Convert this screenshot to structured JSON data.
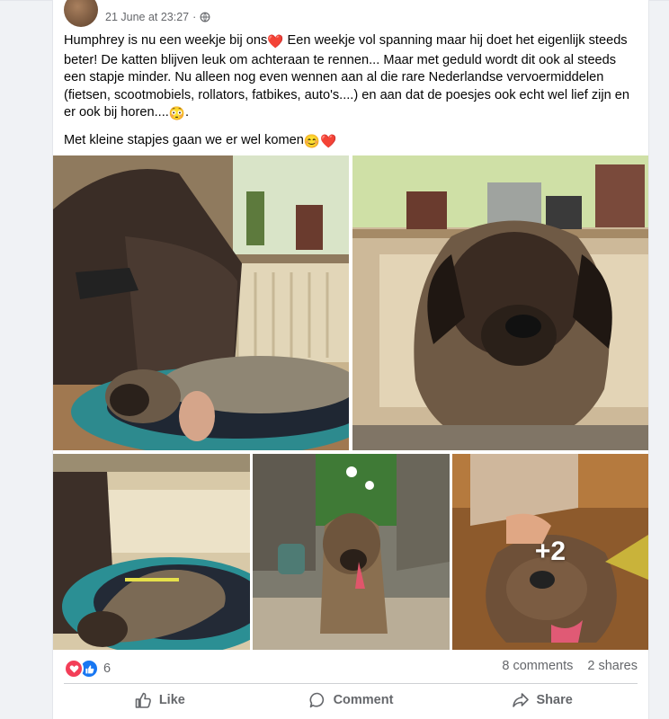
{
  "post": {
    "timestamp": "21 June at 23:27",
    "separator": "·",
    "paragraph1_a": "Humphrey is nu een weekje bij ons",
    "paragraph1_b": " Een weekje vol spanning maar hij doet het eigenlijk steeds beter! De katten blijven leuk om achteraan te rennen... Maar met geduld wordt dit ook al steeds een stapje minder. Nu alleen nog even wennen aan al die rare Nederlandse vervoermiddelen (fietsen, scootmobiels, rollators, fatbikes, auto's....) en aan dat de poesjes ook echt wel lief zijn en er ook bij horen....",
    "paragraph1_end": ".",
    "paragraph2": "Met kleine stapjes gaan we er wel komen",
    "emojis": {
      "heart": "❤️",
      "grimace": "😳",
      "smile": "😊"
    }
  },
  "photos": {
    "more_count": "+2",
    "items": [
      {
        "name": "dog-lying-on-bed-with-toy"
      },
      {
        "name": "dog-closeup-by-window"
      },
      {
        "name": "dog-sleeping-on-back"
      },
      {
        "name": "dog-sitting-in-garden"
      },
      {
        "name": "dog-being-petted"
      }
    ]
  },
  "stats": {
    "reaction_count": "6",
    "comments": "8 comments",
    "shares": "2 shares"
  },
  "actions": {
    "like": "Like",
    "comment": "Comment",
    "share": "Share"
  },
  "colors": {
    "accent": "#1877f2",
    "love": "#f33e58",
    "secondary_text": "#65676b"
  }
}
